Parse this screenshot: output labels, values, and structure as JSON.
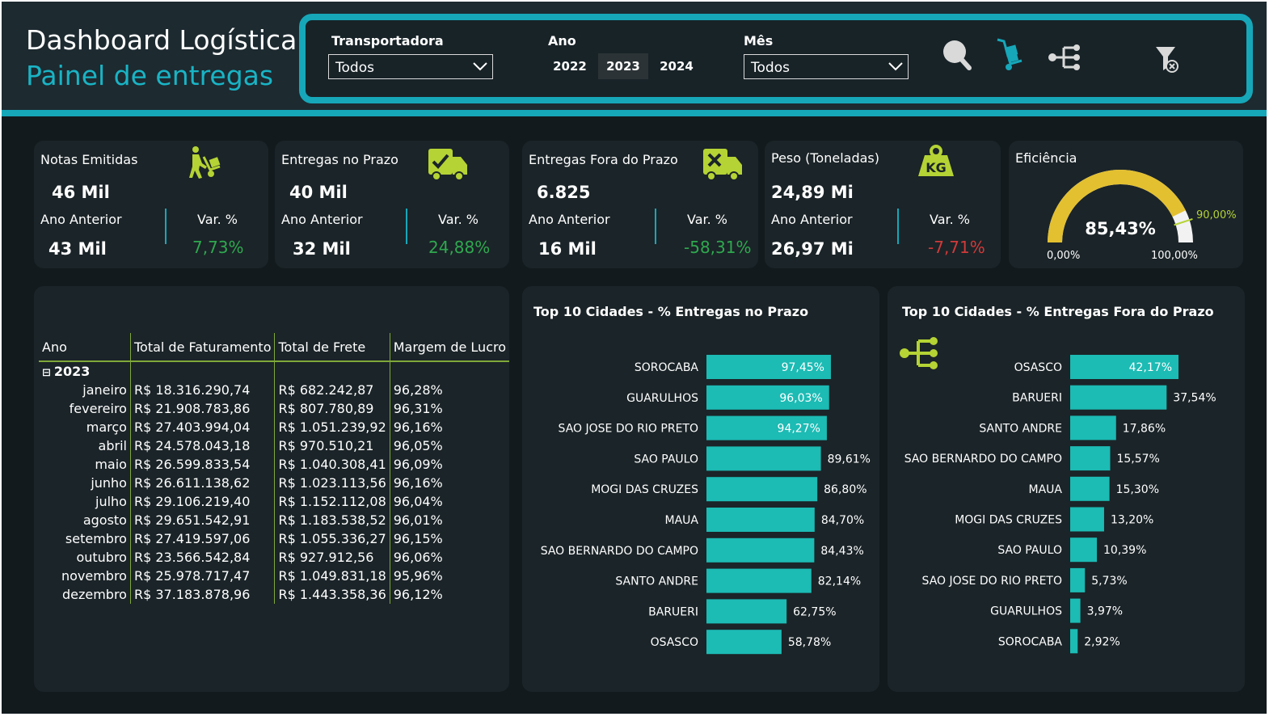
{
  "header": {
    "title": "Dashboard Logística",
    "subtitle": "Painel de entregas"
  },
  "filters": {
    "transportadora_label": "Transportadora",
    "transportadora_value": "Todos",
    "ano_label": "Ano",
    "years": [
      "2022",
      "2023",
      "2024"
    ],
    "selected_year": "2023",
    "mes_label": "Mês",
    "mes_value": "Todos"
  },
  "cards": [
    {
      "title": "Notas Emitidas",
      "value": "46 Mil",
      "prev_label": "Ano Anterior",
      "prev_value": "43 Mil",
      "var_label": "Var. %",
      "var_value": "7,73%",
      "var_color": "#2fa84f",
      "icon": "hand-truck-icon"
    },
    {
      "title": "Entregas no Prazo",
      "value": "40 Mil",
      "prev_label": "Ano Anterior",
      "prev_value": "32 Mil",
      "var_label": "Var. %",
      "var_value": "24,88%",
      "var_color": "#2fa84f",
      "icon": "truck-check-icon"
    },
    {
      "title": "Entregas Fora do Prazo",
      "value": "6.825",
      "prev_label": "Ano Anterior",
      "prev_value": "16 Mil",
      "var_label": "Var. %",
      "var_value": "-58,31%",
      "var_color": "#2fa84f",
      "icon": "truck-x-icon"
    },
    {
      "title": "Peso (Toneladas)",
      "value": "24,89 Mi",
      "prev_label": "Ano Anterior",
      "prev_value": "26,97 Mi",
      "var_label": "Var. %",
      "var_value": "-7,71%",
      "var_color": "#d13a3a",
      "icon": "weight-kg-icon"
    }
  ],
  "efficiency": {
    "title": "Eficiência",
    "value_label": "85,43%",
    "value": 0.8543,
    "target_label": "90,00%",
    "target": 0.9,
    "min_label": "0,00%",
    "max_label": "100,00%",
    "fill_color": "#e3c030",
    "rest_color": "#f2f2f2",
    "target_color": "#b5d334"
  },
  "table": {
    "headers": [
      "Ano",
      "Total de Faturamento",
      "Total de Frete",
      "Margem de Lucro"
    ],
    "year": "2023",
    "expand_glyph": "⊟",
    "rows": [
      {
        "month": "janeiro",
        "fat": "R$ 18.316.290,74",
        "frete": "R$ 682.242,87",
        "margem": "96,28%"
      },
      {
        "month": "fevereiro",
        "fat": "R$ 21.908.783,86",
        "frete": "R$ 807.780,89",
        "margem": "96,31%"
      },
      {
        "month": "março",
        "fat": "R$ 27.403.994,04",
        "frete": "R$ 1.051.239,92",
        "margem": "96,16%"
      },
      {
        "month": "abril",
        "fat": "R$ 24.578.043,18",
        "frete": "R$ 970.510,21",
        "margem": "96,05%"
      },
      {
        "month": "maio",
        "fat": "R$ 26.599.833,54",
        "frete": "R$ 1.040.308,41",
        "margem": "96,09%"
      },
      {
        "month": "junho",
        "fat": "R$ 26.611.138,62",
        "frete": "R$ 1.023.113,56",
        "margem": "96,16%"
      },
      {
        "month": "julho",
        "fat": "R$ 29.106.219,40",
        "frete": "R$ 1.152.112,08",
        "margem": "96,04%"
      },
      {
        "month": "agosto",
        "fat": "R$ 29.651.542,91",
        "frete": "R$ 1.183.538,52",
        "margem": "96,01%"
      },
      {
        "month": "setembro",
        "fat": "R$ 27.419.597,06",
        "frete": "R$ 1.055.336,27",
        "margem": "96,15%"
      },
      {
        "month": "outubro",
        "fat": "R$ 23.566.542,84",
        "frete": "R$ 927.912,56",
        "margem": "96,06%"
      },
      {
        "month": "novembro",
        "fat": "R$ 25.978.717,47",
        "frete": "R$ 1.049.831,18",
        "margem": "95,96%"
      },
      {
        "month": "dezembro",
        "fat": "R$ 37.183.878,96",
        "frete": "R$ 1.443.358,36",
        "margem": "96,12%"
      }
    ]
  },
  "chart_data": [
    {
      "type": "bar",
      "orientation": "horizontal",
      "title": "Top  10 Cidades - % Entregas no Prazo",
      "categories": [
        "SOROCABA",
        "GUARULHOS",
        "SAO JOSE DO RIO PRETO",
        "SAO PAULO",
        "MOGI DAS CRUZES",
        "MAUA",
        "SAO BERNARDO DO CAMPO",
        "SANTO ANDRE",
        "BARUERI",
        "OSASCO"
      ],
      "values": [
        97.45,
        96.03,
        94.27,
        89.61,
        86.8,
        84.7,
        84.43,
        82.14,
        62.75,
        58.78
      ],
      "labels": [
        "97,45%",
        "96,03%",
        "94,27%",
        "89,61%",
        "86,80%",
        "84,70%",
        "84,43%",
        "82,14%",
        "62,75%",
        "58,78%"
      ],
      "bar_color": "#1cbbb4",
      "xlim": [
        0,
        100
      ]
    },
    {
      "type": "bar",
      "orientation": "horizontal",
      "title": "Top  10 Cidades - % Entregas Fora do Prazo",
      "categories": [
        "OSASCO",
        "BARUERI",
        "SANTO ANDRE",
        "SAO BERNARDO DO CAMPO",
        "MAUA",
        "MOGI DAS CRUZES",
        "SAO PAULO",
        "SAO JOSE DO RIO PRETO",
        "GUARULHOS",
        "SOROCABA"
      ],
      "values": [
        42.17,
        37.54,
        17.86,
        15.57,
        15.3,
        13.2,
        10.39,
        5.73,
        3.97,
        2.92
      ],
      "labels": [
        "42,17%",
        "37,54%",
        "17,86%",
        "15,57%",
        "15,30%",
        "13,20%",
        "10,39%",
        "5,73%",
        "3,97%",
        "2,92%"
      ],
      "bar_color": "#1cbbb4",
      "xlim": [
        0,
        42.17
      ]
    }
  ]
}
